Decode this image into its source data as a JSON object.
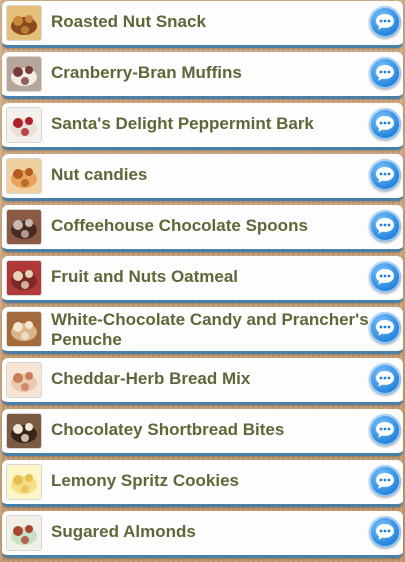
{
  "items": [
    {
      "label": "Roasted Nut Snack",
      "icon": "roasted-nut-snack-thumbnail",
      "thumb_colors": [
        "#8b4a1e",
        "#c88a3a",
        "#e4c07a"
      ]
    },
    {
      "label": "Cranberry-Bran Muffins",
      "icon": "cranberry-bran-muffins-thumbnail",
      "thumb_colors": [
        "#f2ece4",
        "#7a3b3b",
        "#b6a79a"
      ]
    },
    {
      "label": "Santa's Delight Peppermint Bark",
      "icon": "peppermint-bark-thumbnail",
      "thumb_colors": [
        "#e8e0d6",
        "#b21e2a",
        "#f4f1ec"
      ]
    },
    {
      "label": "Nut candies",
      "icon": "nut-candies-thumbnail",
      "thumb_colors": [
        "#e6a35a",
        "#b05d1f",
        "#f0d0a0"
      ]
    },
    {
      "label": "Coffeehouse Chocolate Spoons",
      "icon": "chocolate-spoons-thumbnail",
      "thumb_colors": [
        "#4a2b20",
        "#c8b8b0",
        "#8a5a44"
      ]
    },
    {
      "label": "Fruit and Nuts Oatmeal",
      "icon": "fruit-nuts-oatmeal-thumbnail",
      "thumb_colors": [
        "#7a2a2a",
        "#e7d2b4",
        "#b13838"
      ]
    },
    {
      "label": "White-Chocolate Candy and Prancher's Penuche",
      "icon": "penuche-thumbnail",
      "thumb_colors": [
        "#d8b48a",
        "#f4e6d0",
        "#a36a3c"
      ]
    },
    {
      "label": "Cheddar-Herb Bread Mix",
      "icon": "bread-mix-thumbnail",
      "thumb_colors": [
        "#e9c9b0",
        "#c97c5a",
        "#f6e4d4"
      ]
    },
    {
      "label": "Chocolatey Shortbread Bites",
      "icon": "shortbread-bites-thumbnail",
      "thumb_colors": [
        "#3a2418",
        "#efe6d8",
        "#7a5a40"
      ]
    },
    {
      "label": "Lemony Spritz Cookies",
      "icon": "spritz-cookies-thumbnail",
      "thumb_colors": [
        "#f4e08a",
        "#e8c050",
        "#fff6c8"
      ]
    },
    {
      "label": "Sugared Almonds",
      "icon": "sugared-almonds-thumbnail",
      "thumb_colors": [
        "#c8e0c8",
        "#a8462c",
        "#f2efe6"
      ]
    }
  ],
  "action_icon": "chat-bubble-icon",
  "colors": {
    "title_text": "#5f6638",
    "row_bg": "#fdfdfd",
    "row_border": "#4a7fa8",
    "chat_button": "#1e7fd8"
  }
}
